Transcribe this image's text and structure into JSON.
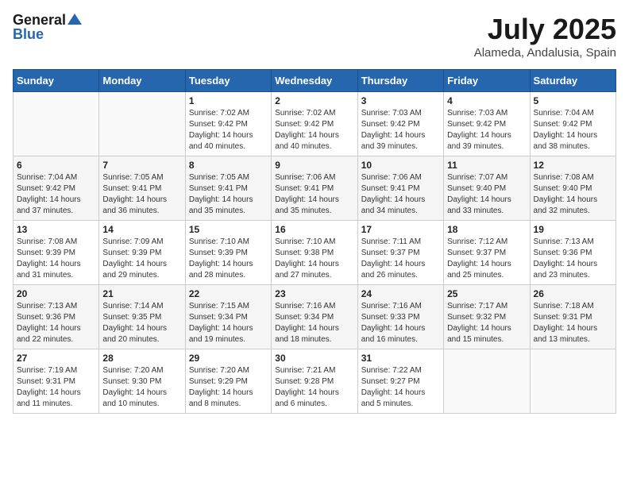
{
  "header": {
    "logo_general": "General",
    "logo_blue": "Blue",
    "month_year": "July 2025",
    "location": "Alameda, Andalusia, Spain"
  },
  "days_of_week": [
    "Sunday",
    "Monday",
    "Tuesday",
    "Wednesday",
    "Thursday",
    "Friday",
    "Saturday"
  ],
  "weeks": [
    [
      {
        "day": "",
        "content": ""
      },
      {
        "day": "",
        "content": ""
      },
      {
        "day": "1",
        "content": "Sunrise: 7:02 AM\nSunset: 9:42 PM\nDaylight: 14 hours and 40 minutes."
      },
      {
        "day": "2",
        "content": "Sunrise: 7:02 AM\nSunset: 9:42 PM\nDaylight: 14 hours and 40 minutes."
      },
      {
        "day": "3",
        "content": "Sunrise: 7:03 AM\nSunset: 9:42 PM\nDaylight: 14 hours and 39 minutes."
      },
      {
        "day": "4",
        "content": "Sunrise: 7:03 AM\nSunset: 9:42 PM\nDaylight: 14 hours and 39 minutes."
      },
      {
        "day": "5",
        "content": "Sunrise: 7:04 AM\nSunset: 9:42 PM\nDaylight: 14 hours and 38 minutes."
      }
    ],
    [
      {
        "day": "6",
        "content": "Sunrise: 7:04 AM\nSunset: 9:42 PM\nDaylight: 14 hours and 37 minutes."
      },
      {
        "day": "7",
        "content": "Sunrise: 7:05 AM\nSunset: 9:41 PM\nDaylight: 14 hours and 36 minutes."
      },
      {
        "day": "8",
        "content": "Sunrise: 7:05 AM\nSunset: 9:41 PM\nDaylight: 14 hours and 35 minutes."
      },
      {
        "day": "9",
        "content": "Sunrise: 7:06 AM\nSunset: 9:41 PM\nDaylight: 14 hours and 35 minutes."
      },
      {
        "day": "10",
        "content": "Sunrise: 7:06 AM\nSunset: 9:41 PM\nDaylight: 14 hours and 34 minutes."
      },
      {
        "day": "11",
        "content": "Sunrise: 7:07 AM\nSunset: 9:40 PM\nDaylight: 14 hours and 33 minutes."
      },
      {
        "day": "12",
        "content": "Sunrise: 7:08 AM\nSunset: 9:40 PM\nDaylight: 14 hours and 32 minutes."
      }
    ],
    [
      {
        "day": "13",
        "content": "Sunrise: 7:08 AM\nSunset: 9:39 PM\nDaylight: 14 hours and 31 minutes."
      },
      {
        "day": "14",
        "content": "Sunrise: 7:09 AM\nSunset: 9:39 PM\nDaylight: 14 hours and 29 minutes."
      },
      {
        "day": "15",
        "content": "Sunrise: 7:10 AM\nSunset: 9:39 PM\nDaylight: 14 hours and 28 minutes."
      },
      {
        "day": "16",
        "content": "Sunrise: 7:10 AM\nSunset: 9:38 PM\nDaylight: 14 hours and 27 minutes."
      },
      {
        "day": "17",
        "content": "Sunrise: 7:11 AM\nSunset: 9:37 PM\nDaylight: 14 hours and 26 minutes."
      },
      {
        "day": "18",
        "content": "Sunrise: 7:12 AM\nSunset: 9:37 PM\nDaylight: 14 hours and 25 minutes."
      },
      {
        "day": "19",
        "content": "Sunrise: 7:13 AM\nSunset: 9:36 PM\nDaylight: 14 hours and 23 minutes."
      }
    ],
    [
      {
        "day": "20",
        "content": "Sunrise: 7:13 AM\nSunset: 9:36 PM\nDaylight: 14 hours and 22 minutes."
      },
      {
        "day": "21",
        "content": "Sunrise: 7:14 AM\nSunset: 9:35 PM\nDaylight: 14 hours and 20 minutes."
      },
      {
        "day": "22",
        "content": "Sunrise: 7:15 AM\nSunset: 9:34 PM\nDaylight: 14 hours and 19 minutes."
      },
      {
        "day": "23",
        "content": "Sunrise: 7:16 AM\nSunset: 9:34 PM\nDaylight: 14 hours and 18 minutes."
      },
      {
        "day": "24",
        "content": "Sunrise: 7:16 AM\nSunset: 9:33 PM\nDaylight: 14 hours and 16 minutes."
      },
      {
        "day": "25",
        "content": "Sunrise: 7:17 AM\nSunset: 9:32 PM\nDaylight: 14 hours and 15 minutes."
      },
      {
        "day": "26",
        "content": "Sunrise: 7:18 AM\nSunset: 9:31 PM\nDaylight: 14 hours and 13 minutes."
      }
    ],
    [
      {
        "day": "27",
        "content": "Sunrise: 7:19 AM\nSunset: 9:31 PM\nDaylight: 14 hours and 11 minutes."
      },
      {
        "day": "28",
        "content": "Sunrise: 7:20 AM\nSunset: 9:30 PM\nDaylight: 14 hours and 10 minutes."
      },
      {
        "day": "29",
        "content": "Sunrise: 7:20 AM\nSunset: 9:29 PM\nDaylight: 14 hours and 8 minutes."
      },
      {
        "day": "30",
        "content": "Sunrise: 7:21 AM\nSunset: 9:28 PM\nDaylight: 14 hours and 6 minutes."
      },
      {
        "day": "31",
        "content": "Sunrise: 7:22 AM\nSunset: 9:27 PM\nDaylight: 14 hours and 5 minutes."
      },
      {
        "day": "",
        "content": ""
      },
      {
        "day": "",
        "content": ""
      }
    ]
  ]
}
